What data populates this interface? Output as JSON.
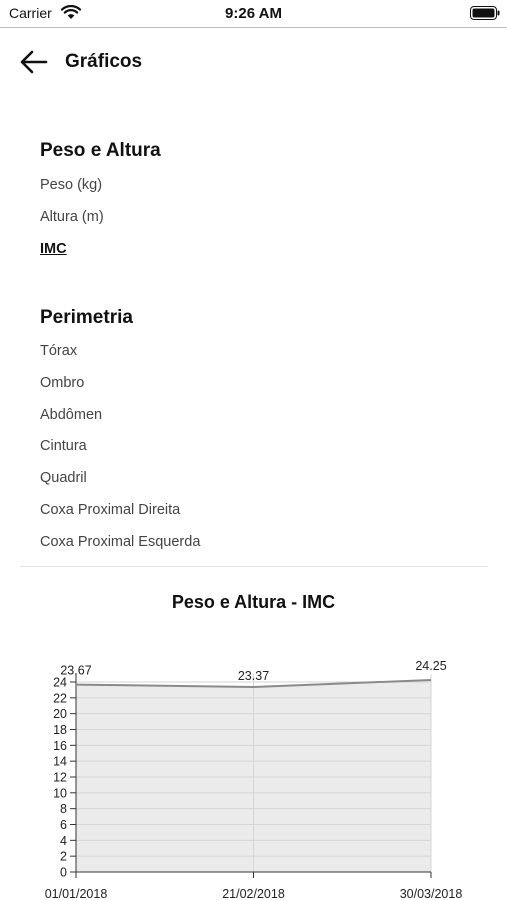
{
  "status_bar": {
    "carrier": "Carrier",
    "time": "9:26 AM"
  },
  "header": {
    "title": "Gráficos",
    "back_icon": "arrow-left-icon"
  },
  "sections": [
    {
      "title": "Peso e Altura",
      "items": [
        {
          "label": "Peso (kg)",
          "active": false
        },
        {
          "label": "Altura (m)",
          "active": false
        },
        {
          "label": "IMC",
          "active": true
        }
      ]
    },
    {
      "title": "Perimetria",
      "items": [
        {
          "label": "Tórax",
          "active": false
        },
        {
          "label": "Ombro",
          "active": false
        },
        {
          "label": "Abdômen",
          "active": false
        },
        {
          "label": "Cintura",
          "active": false
        },
        {
          "label": "Quadril",
          "active": false
        },
        {
          "label": "Coxa Proximal Direita",
          "active": false
        },
        {
          "label": "Coxa Proximal Esquerda",
          "active": false
        }
      ]
    }
  ],
  "chart_data": {
    "type": "area",
    "title": "Peso e Altura - IMC",
    "categories": [
      "01/01/2018",
      "21/02/2018",
      "30/03/2018"
    ],
    "series": [
      {
        "values": [
          23.67,
          23.37,
          24.25
        ]
      }
    ],
    "data_labels": [
      "23.67",
      "23.37",
      "24.25"
    ],
    "yticks": [
      0,
      2,
      4,
      6,
      8,
      10,
      12,
      14,
      16,
      18,
      20,
      22,
      24
    ],
    "ylim": [
      0,
      24.25
    ],
    "grid": true,
    "colors": {
      "fill": "#ebebeb",
      "line": "#8a8a8a",
      "grid": "#d6d6d6"
    }
  }
}
